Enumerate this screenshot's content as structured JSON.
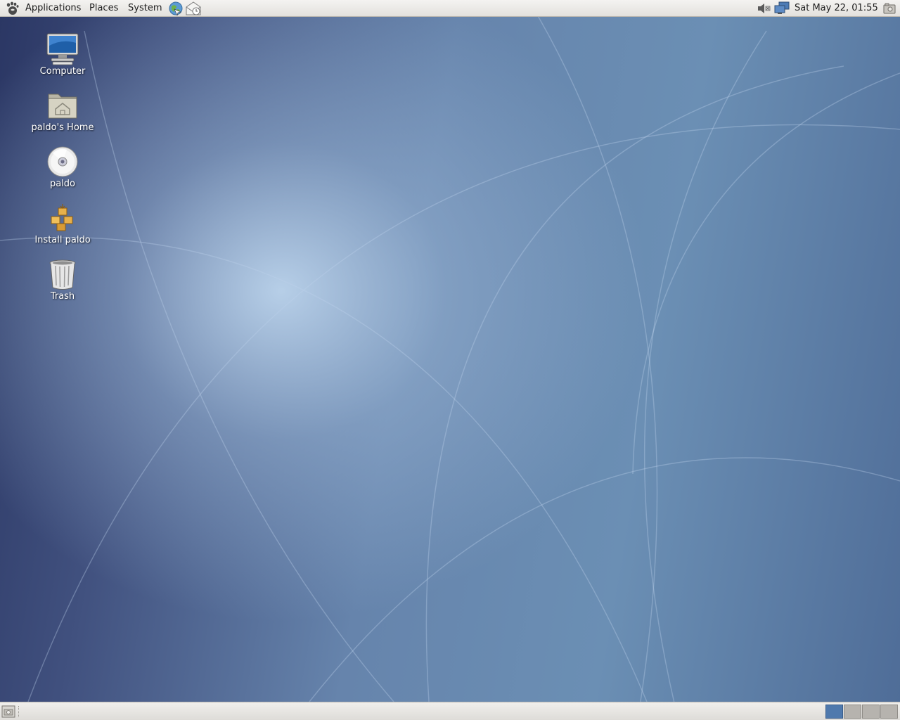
{
  "top_panel": {
    "menus": {
      "applications": "Applications",
      "places": "Places",
      "system": "System"
    },
    "launchers": [
      "web-browser-icon",
      "mail-icon"
    ],
    "tray_icons": [
      "volume-icon",
      "network-icon"
    ],
    "clock": "Sat May 22, 01:55"
  },
  "desktop": {
    "icons": [
      {
        "label": "Computer",
        "icon": "computer-icon"
      },
      {
        "label": "paldo's Home",
        "icon": "home-folder-icon"
      },
      {
        "label": "paldo",
        "icon": "optical-disc-icon"
      },
      {
        "label": "Install paldo",
        "icon": "installer-icon"
      },
      {
        "label": "Trash",
        "icon": "trash-icon"
      }
    ]
  },
  "bottom_panel": {
    "workspaces": 4,
    "active_workspace": 1
  },
  "colors": {
    "panel": "#e8e6e2",
    "desktop_base": "#5a7aa3",
    "workspace_active": "#4f79ad"
  }
}
